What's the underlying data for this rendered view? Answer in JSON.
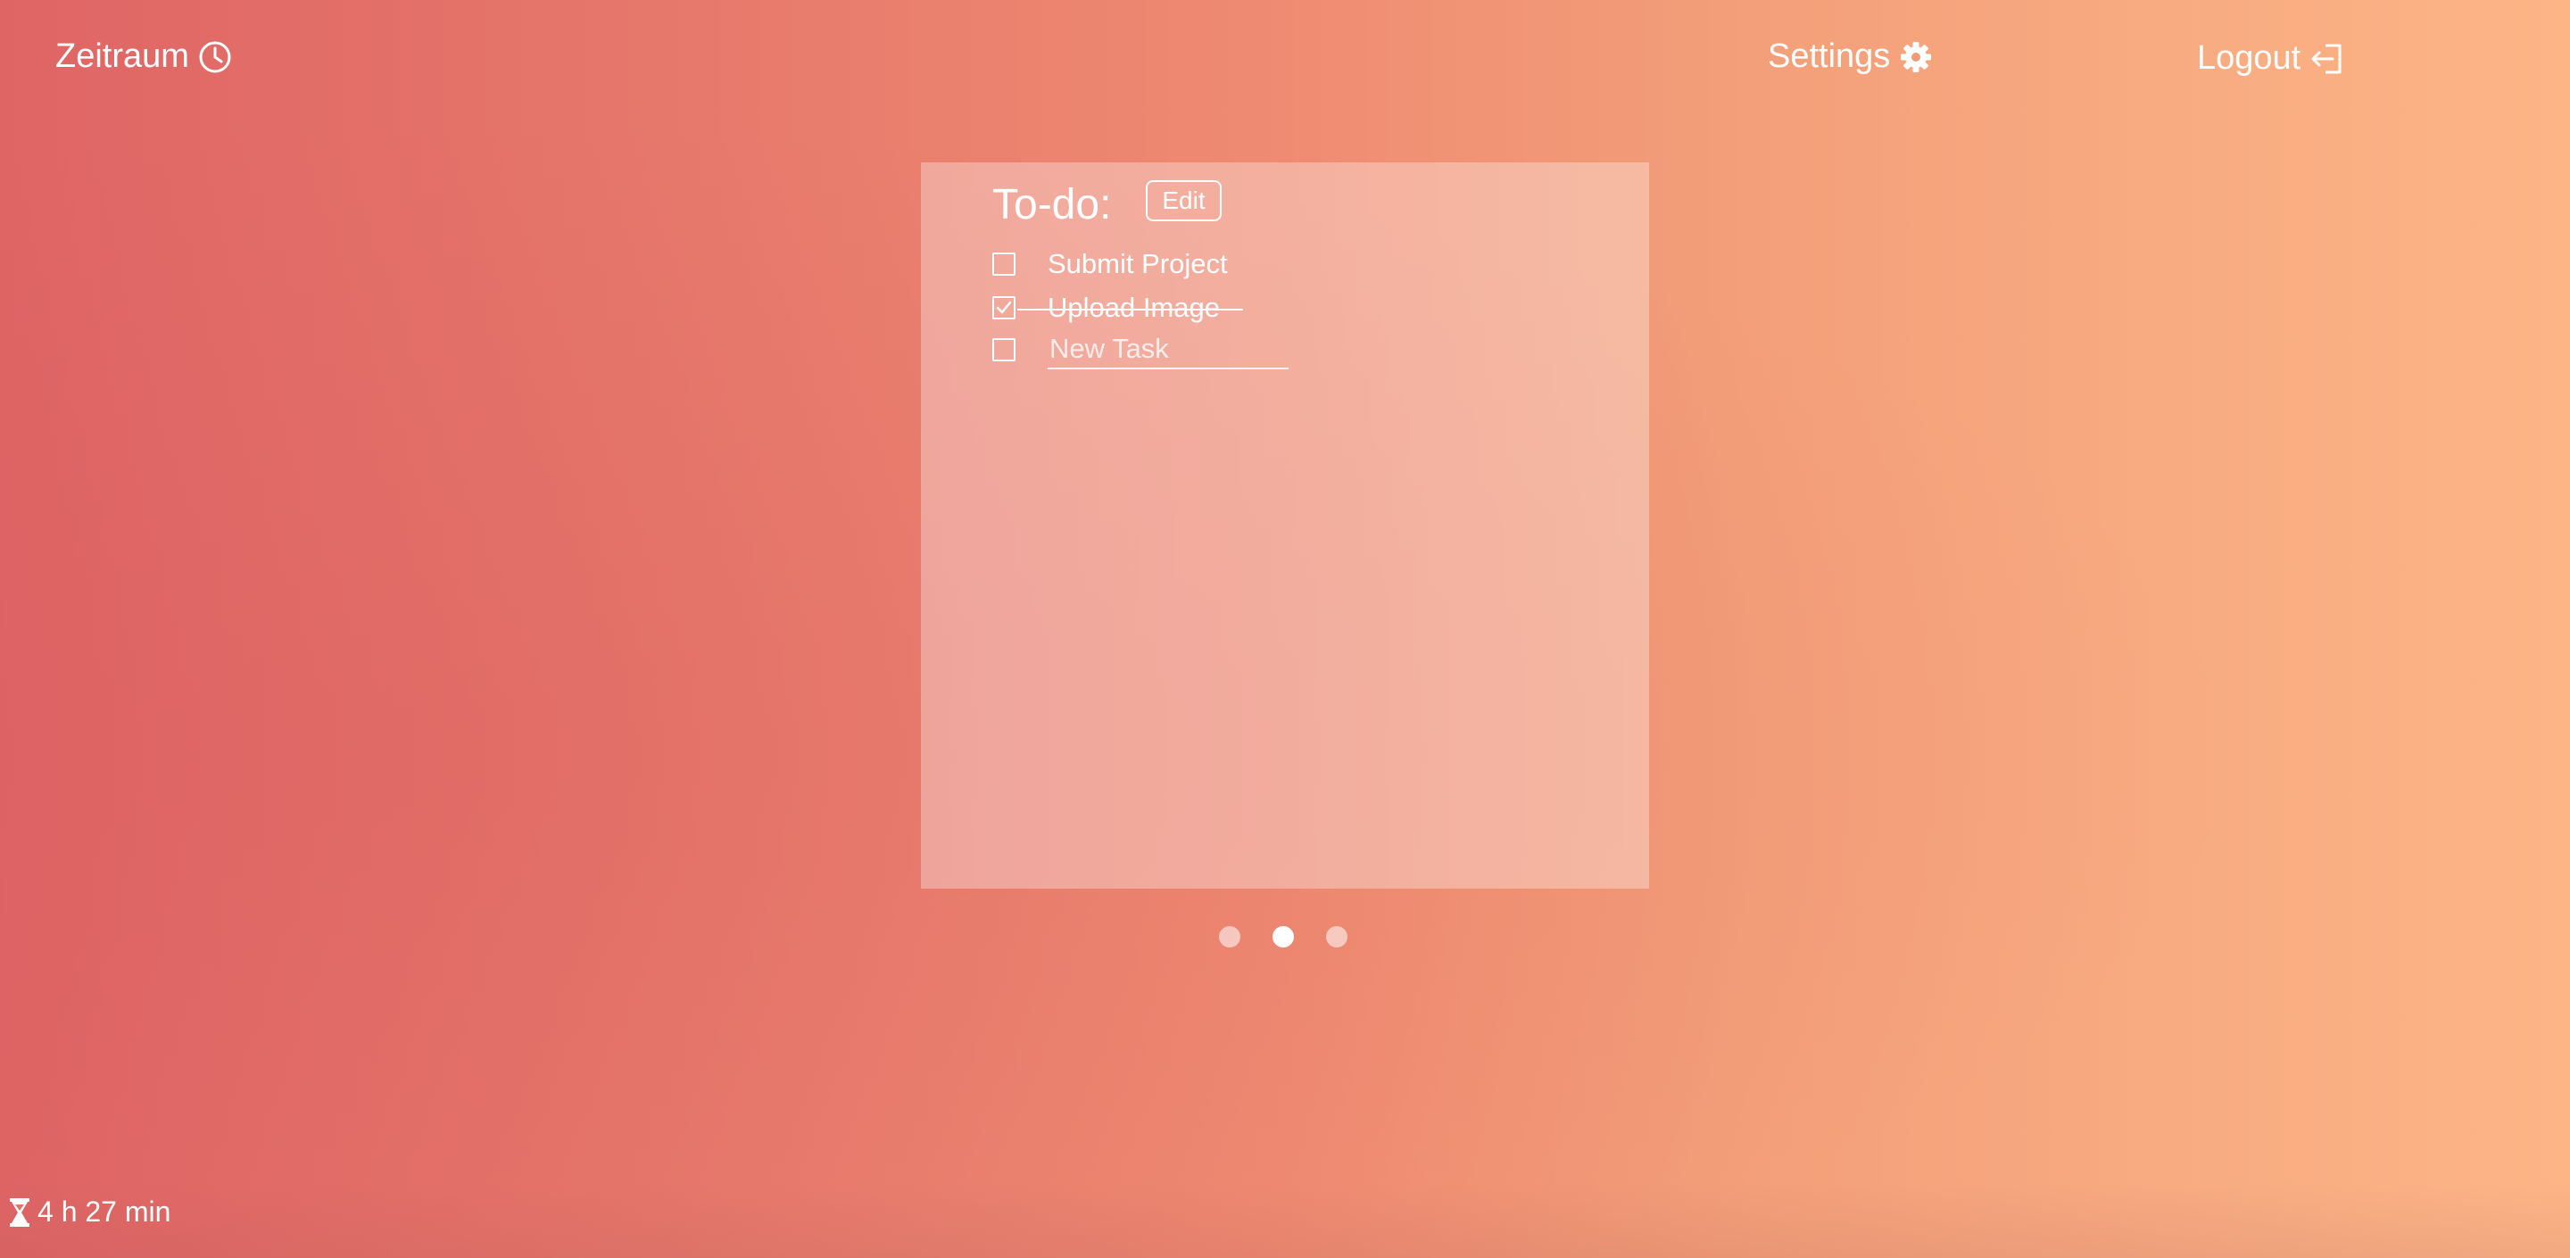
{
  "colors": {
    "gradient_start": "#df6565",
    "gradient_end": "#fdb586",
    "text": "#ffffff",
    "card_bg": "rgba(255,255,255,0.32)"
  },
  "header": {
    "brand": {
      "label": "Zeitraum",
      "icon": "clock-icon"
    },
    "settings": {
      "label": "Settings",
      "icon": "gear-icon"
    },
    "logout": {
      "label": "Logout",
      "icon": "logout-icon"
    }
  },
  "todo": {
    "title": "To-do:",
    "edit_label": "Edit",
    "tasks": [
      {
        "label": "Submit Project",
        "checked": false
      },
      {
        "label": "Upload Image",
        "checked": true
      }
    ],
    "new_task": {
      "placeholder": "New Task",
      "value": ""
    }
  },
  "pager": {
    "pages": 3,
    "active_index": 1
  },
  "footer": {
    "timer_text": "4 h 27 min",
    "icon": "hourglass-icon"
  }
}
